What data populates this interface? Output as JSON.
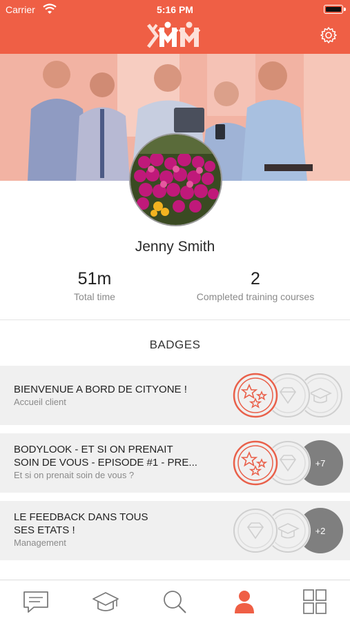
{
  "status_bar": {
    "carrier": "Carrier",
    "time": "5:16 PM"
  },
  "header": {
    "logo_icon": "kmm-logo",
    "settings_icon": "gear-icon",
    "accent_color": "#ef5f45"
  },
  "profile": {
    "name": "Jenny Smith",
    "stats": [
      {
        "value": "51m",
        "label": "Total time"
      },
      {
        "value": "2",
        "label": "Completed training courses"
      }
    ]
  },
  "badges_section": {
    "title": "BADGES",
    "items": [
      {
        "title_line1": "BIENVENUE A BORD DE CITYONE !",
        "title_line2": "",
        "subtitle": "Accueil client",
        "badges": [
          "stars-badge-earned",
          "diamond-badge",
          "graduation-badge"
        ]
      },
      {
        "title_line1": "BODYLOOK - ET SI ON PRENAIT",
        "title_line2": "SOIN DE VOUS - EPISODE #1 - PRE...",
        "subtitle": "Et si on prenait soin de vous ?",
        "badges": [
          "stars-badge-earned",
          "diamond-badge"
        ],
        "more": "+7"
      },
      {
        "title_line1": "LE FEEDBACK DANS TOUS",
        "title_line2": "SES ETATS !",
        "subtitle": "Management",
        "badges": [
          "diamond-badge",
          "graduation-badge"
        ],
        "more": "+2"
      }
    ]
  },
  "tab_bar": {
    "tabs": [
      "messages-icon",
      "courses-icon",
      "search-icon",
      "profile-icon",
      "grid-icon"
    ],
    "active": "profile-icon"
  }
}
